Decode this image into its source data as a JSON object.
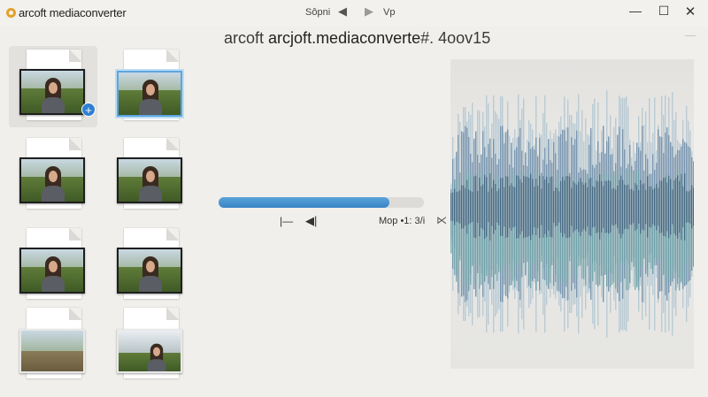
{
  "window": {
    "title": "arcoft mediaconverter",
    "center_label": "Sôpni",
    "right_label": "Vp",
    "prev_icon": "◀",
    "next_icon": "▶",
    "minimize": "—",
    "maximize": "☐",
    "close": "✕"
  },
  "document": {
    "title_prefix": "arcoft",
    "title_main": "arcjoft.mediaconverte",
    "title_suffix": "#. 4oov15"
  },
  "files": [
    {
      "selected": true,
      "badge": "+"
    },
    {
      "selected_frame": true
    },
    {},
    {},
    {},
    {},
    {
      "dirt": true,
      "no_person": true
    },
    {
      "no_frame": true
    }
  ],
  "progress": {
    "fraction": 0.83
  },
  "controls": {
    "first_icon": "|—",
    "back_icon": "◀|",
    "status": "Mop •1: 3/i",
    "collapse_icon": "⋉"
  },
  "waveform": {
    "colors": [
      "#6f8eab",
      "#3f6480",
      "#6aa0a6",
      "#93b4c8"
    ]
  }
}
